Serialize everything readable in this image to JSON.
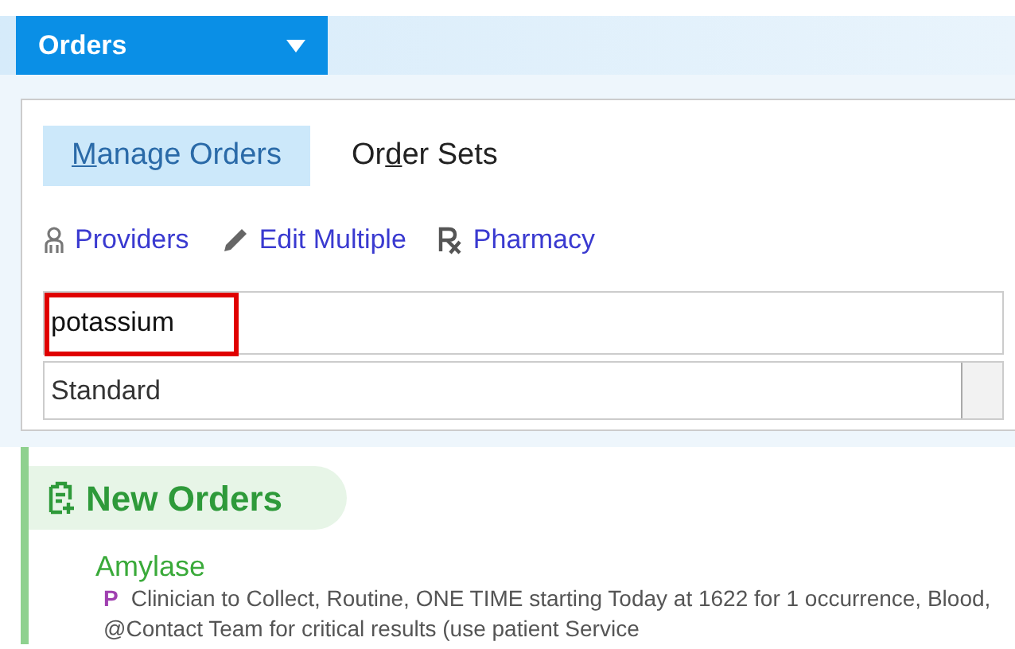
{
  "header_tab": {
    "label": "Orders"
  },
  "view_tabs": [
    {
      "access_key": "M",
      "label_after": "anage Orders",
      "selected": true
    },
    {
      "label_before": "Or",
      "access_key": "d",
      "label_after": "er Sets",
      "selected": false
    }
  ],
  "toolbar": [
    {
      "kind": "person",
      "label": "Providers"
    },
    {
      "kind": "pencil",
      "label": "Edit Multiple"
    },
    {
      "kind": "rx",
      "label": "Pharmacy"
    }
  ],
  "search": {
    "value": "potassium",
    "highlighted": true
  },
  "list_select": {
    "value": "Standard"
  },
  "new_orders": {
    "title": "New Orders",
    "items": [
      {
        "name": "Amylase",
        "badge": "P",
        "details": "Clinician to Collect, Routine, ONE TIME starting Today at 1622 for 1 occurrence, Blood, @Contact Team for critical results (use patient Service"
      }
    ]
  }
}
